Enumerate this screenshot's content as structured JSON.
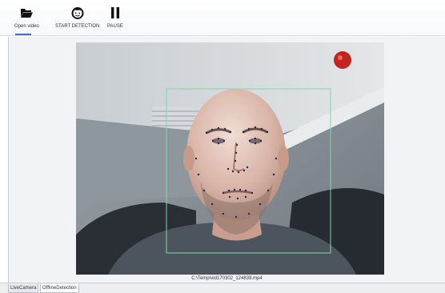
{
  "toolbar": {
    "open_video": {
      "label": "Open video",
      "icon": "folder-open-icon"
    },
    "start_detection": {
      "label": "START DETECTION",
      "icon": "face-icon"
    },
    "pause": {
      "label": "PAUSE",
      "icon": "pause-icon"
    }
  },
  "video": {
    "file_path": "C:\\Temp\\vid170302_124839.mp4"
  },
  "tabs": [
    {
      "label": "LiveCamera"
    },
    {
      "label": "OfflineDetection"
    }
  ],
  "colors": {
    "accent": "#3c6fd1",
    "bounding_box": "#7fd6b0",
    "landmark": "#1a2a6c"
  }
}
